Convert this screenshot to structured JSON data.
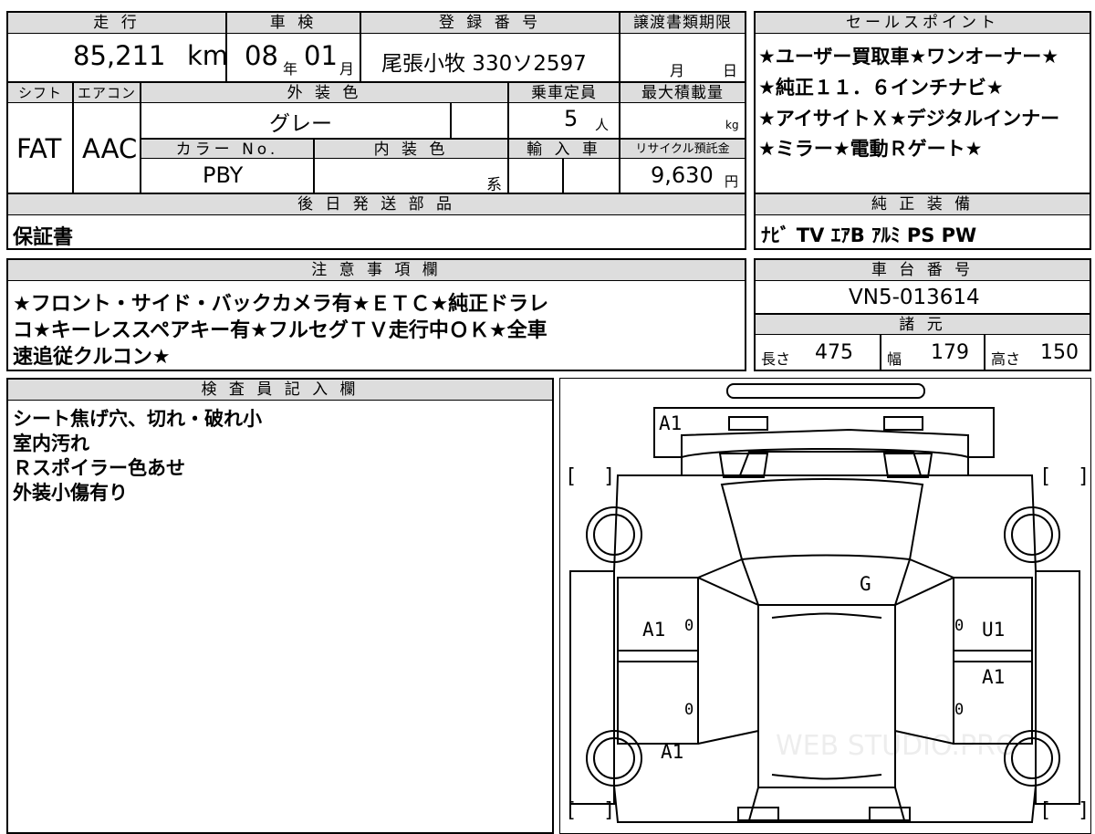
{
  "top": {
    "mileage_label": "走 行",
    "mileage_value": "85,211",
    "mileage_unit": "km",
    "inspection_label": "車 検",
    "inspection_year": "08",
    "inspection_year_unit": "年",
    "inspection_month": "01",
    "inspection_month_unit": "月",
    "registration_label": "登 録 番 号",
    "registration_value": "尾張小牧 330ソ2597",
    "transfer_label": "譲渡書類期限",
    "transfer_month_unit": "月",
    "transfer_day_unit": "日"
  },
  "row2": {
    "shift_label": "シフト",
    "shift_value": "FAT",
    "ac_label": "エアコン",
    "ac_value": "AAC",
    "exterior_color_label": "外 装 色",
    "exterior_color_value": "グレー",
    "capacity_label": "乗車定員",
    "capacity_value": "5",
    "capacity_unit": "人",
    "max_load_label": "最大積載量",
    "max_load_unit": "kg",
    "color_no_label": "カラー No.",
    "color_no_value": "PBY",
    "interior_color_label": "内 装 色",
    "interior_color_suffix": "系",
    "import_label": "輸 入 車",
    "recycle_label": "リサイクル預託金",
    "recycle_value": "9,630",
    "recycle_unit": "円"
  },
  "later_parts": {
    "label": "後 日 発 送 部 品",
    "value": "保証書"
  },
  "sales_points": {
    "label": "セールスポイント",
    "lines": [
      "★ユーザー買取車★ワンオーナー★",
      "★純正１１．６インチナビ★",
      "★アイサイトＸ★デジタルインナー",
      "★ミラー★電動Ｒゲート★"
    ]
  },
  "equipment": {
    "label": "純 正 装 備",
    "value": "ﾅﾋﾞ TV ｴｱB ｱﾙﾐ PS PW"
  },
  "notes": {
    "label": "注 意 事 項 欄",
    "lines": [
      "★フロント・サイド・バックカメラ有★ＥＴＣ★純正ドラレ",
      "コ★キーレススペアキー有★フルセグＴＶ走行中ＯＫ★全車",
      "速追従クルコン★"
    ]
  },
  "chassis": {
    "label": "車 台 番 号",
    "value": "VN5-013614"
  },
  "specs": {
    "label": "諸 元",
    "length_label": "長さ",
    "length_value": "475",
    "width_label": "幅",
    "width_value": "179",
    "height_label": "高さ",
    "height_value": "150"
  },
  "inspector": {
    "label": "検 査 員 記 入 欄",
    "lines": [
      "シート焦げ穴、切れ・破れ小",
      "室内汚れ",
      "Ｒスポイラー色あせ",
      "外装小傷有り"
    ]
  },
  "diagram": {
    "marks": {
      "front_bumper": "A1",
      "windshield": "G",
      "left_front_door": "A1",
      "right_front_door": "U1",
      "right_rear_door": "A1",
      "left_rear_fender": "A1"
    },
    "zeros": [
      "0",
      "0",
      "0",
      "0"
    ],
    "watermark": "WEB STUDIO.PRO"
  }
}
